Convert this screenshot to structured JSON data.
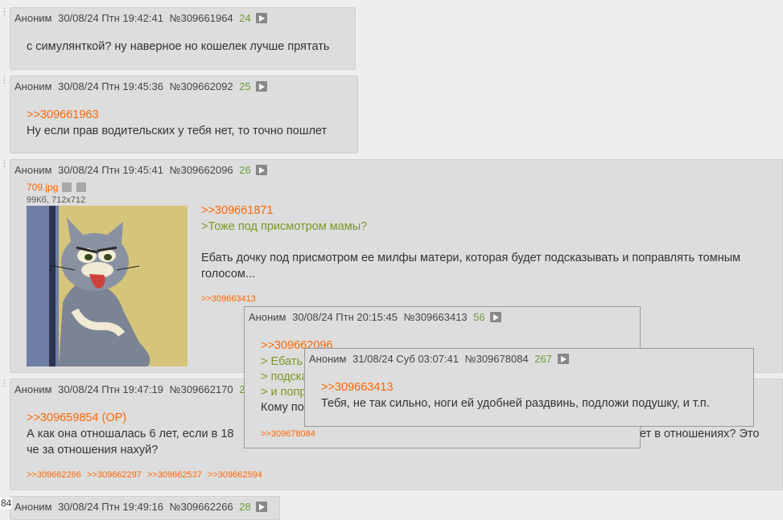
{
  "posts": [
    {
      "name": "Аноним",
      "date": "30/08/24 Птн 19:42:41",
      "num": "№309661964",
      "count": "24",
      "lines": [
        "с симулянткой? ну наверное но кошелек лучше прятать"
      ]
    },
    {
      "name": "Аноним",
      "date": "30/08/24 Птн 19:45:36",
      "num": "№309662092",
      "count": "25",
      "reply": ">>309661963",
      "lines": [
        "Ну если прав водительских у тебя нет, то точно пошлет"
      ]
    },
    {
      "name": "Аноним",
      "date": "30/08/24 Птн 19:45:41",
      "num": "№309662096",
      "count": "26",
      "file_name": "709.jpg",
      "file_meta": "99Кб, 712x712",
      "reply": ">>309661871",
      "quote": ">Тоже под присмотром мамы?",
      "lines": [
        "Ебать дочку под присмотром ее милфы матери, которая будет подсказывать и поправлять томным",
        "голосом..."
      ],
      "replies": [
        ">>309663413"
      ]
    },
    {
      "name": "Аноним",
      "date": "30/08/24 Птн 19:47:19",
      "num": "№309662170",
      "count": "27",
      "reply": ">>309659854 (OP)",
      "lines_left": [
        "А как она отношалась 6 лет, если в 18",
        "че за отношения нахуй?"
      ],
      "line_right": "ет в отношениях? Это",
      "replies": [
        ">>309662266",
        ">>309662297",
        ">>309662537",
        ">>309662594"
      ]
    },
    {
      "name": "Аноним",
      "date": "30/08/24 Птн 19:49:16",
      "num": "№309662266",
      "count": "28"
    }
  ],
  "popup1": {
    "name": "Аноним",
    "date": "30/08/24 Птн 20:15:45",
    "num": "№309663413",
    "count": "56",
    "reply": ">>309662096",
    "quotes": [
      "> Ебать",
      "> подска",
      "> и попр"
    ],
    "text": "Кому по",
    "replies": [
      ">>309678084"
    ]
  },
  "popup2": {
    "name": "Аноним",
    "date": "31/08/24 Суб 03:07:41",
    "num": "№309678084",
    "count": "267",
    "reply": ">>309663413",
    "text": "Тебя, не так сильно, ноги ей удобней раздвинь, подложи подушку, и т.п."
  },
  "edge_number": "84",
  "colors": {
    "background": "#eeeeee",
    "post_bg": "#dddddd",
    "reply_link": "#ff6600",
    "quote": "#789922",
    "count": "#6a9c3a"
  }
}
